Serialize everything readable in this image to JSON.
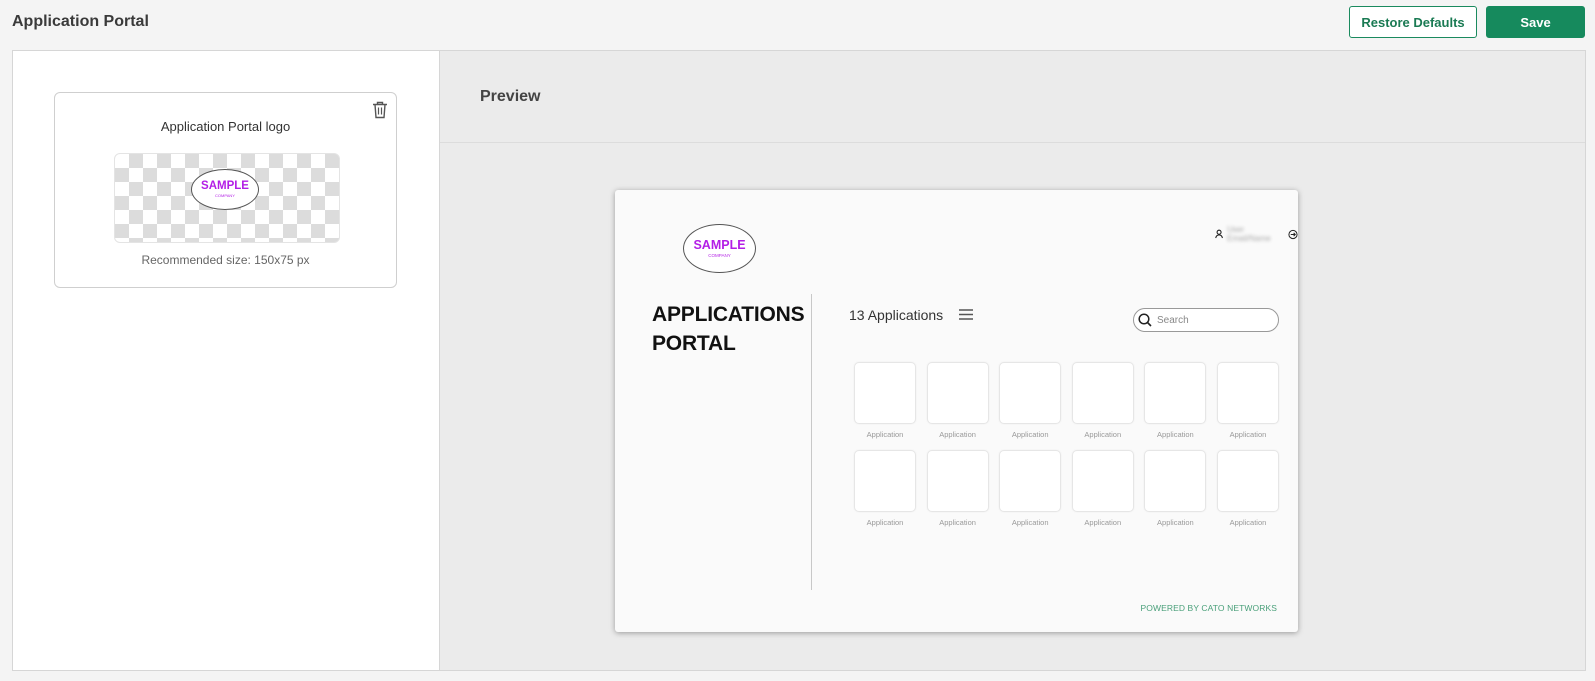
{
  "header": {
    "title": "Application Portal",
    "restore_label": "Restore Defaults",
    "save_label": "Save"
  },
  "logo_card": {
    "title": "Application Portal logo",
    "recommended": "Recommended size: 150x75 px",
    "logo_line1": "SAMPLE",
    "logo_line2": "COMPANY"
  },
  "preview": {
    "title": "Preview",
    "user_name": "User Email/Name",
    "portal_title_line1": "APPLICATIONS",
    "portal_title_line2": "PORTAL",
    "app_count": "13 Applications",
    "search_placeholder": "Search",
    "footer": "POWERED BY CATO NETWORKS",
    "tiles": [
      "Application",
      "Application",
      "Application",
      "Application",
      "Application",
      "Application",
      "Application",
      "Application",
      "Application",
      "Application",
      "Application",
      "Application"
    ]
  },
  "colors": {
    "accent": "#168a5d",
    "logo_text": "#b31ee6",
    "footer_text": "#4aa07a"
  },
  "icons": [
    "trash-icon",
    "user-icon",
    "logout-icon",
    "menu-icon",
    "search-icon"
  ]
}
